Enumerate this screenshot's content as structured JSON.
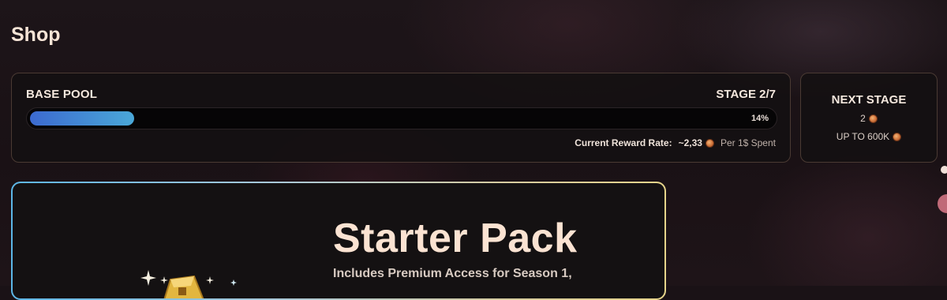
{
  "page": {
    "title": "Shop"
  },
  "pool": {
    "label": "BASE POOL",
    "stage": "STAGE 2/7",
    "progress_percent": 14,
    "progress_text": "14%",
    "reward_label": "Current Reward Rate:",
    "reward_value": "~2,33",
    "reward_suffix": "Per 1$ Spent"
  },
  "next_stage": {
    "title": "NEXT STAGE",
    "value": "2",
    "cap": "UP TO 600K"
  },
  "pack": {
    "title": "Starter Pack",
    "description": "Includes Premium Access for Season 1,"
  },
  "icons": {
    "coin": "coin-icon",
    "sparkle": "sparkle-icon",
    "chest": "chest-icon"
  },
  "colors": {
    "progress_start": "#3c6ad0",
    "progress_end": "#4aa8d8",
    "coin": "#d0733a"
  }
}
